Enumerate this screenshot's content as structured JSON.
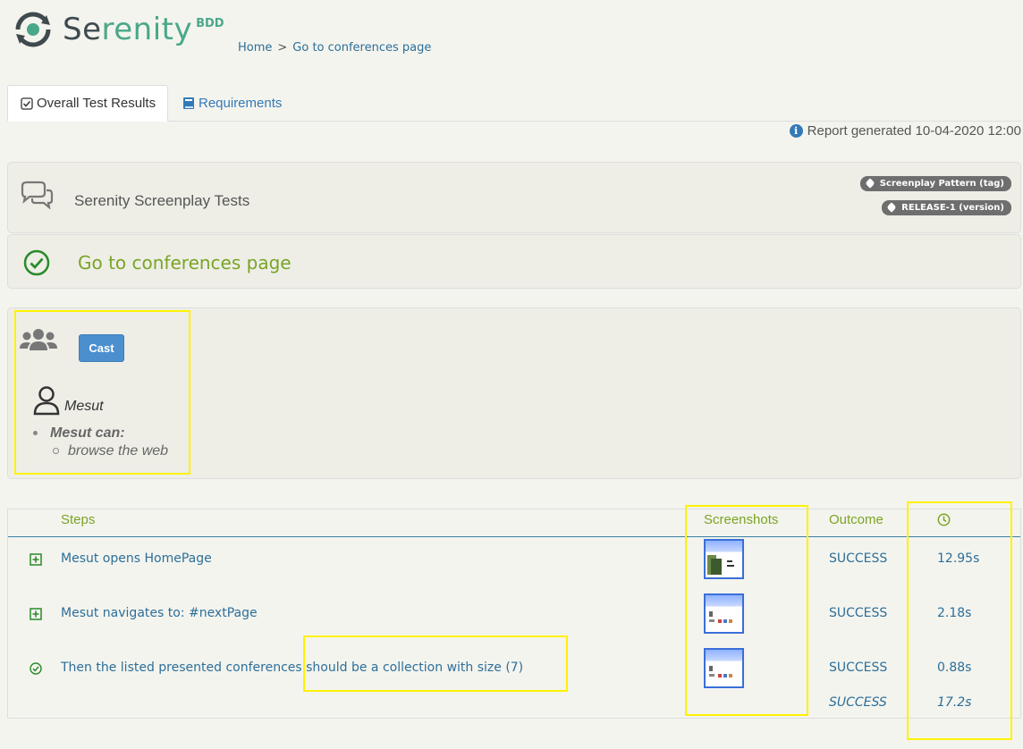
{
  "logo": {
    "brand_a": "Se",
    "brand_b": "renity",
    "sub": "BDD"
  },
  "breadcrumb": {
    "home": "Home",
    "sep": ">",
    "current": "Go to conferences page"
  },
  "tabs": [
    {
      "label": "Overall Test Results",
      "icon": "check-square-icon"
    },
    {
      "label": "Requirements",
      "icon": "book-icon"
    }
  ],
  "report": {
    "generated": "Report generated 10-04-2020 12:00"
  },
  "suite": {
    "title": "Serenity Screenplay Tests",
    "tags": [
      "Screenplay Pattern (tag)",
      "RELEASE-1 (version)"
    ]
  },
  "scenario": {
    "title": "Go to conferences page"
  },
  "cast": {
    "button": "Cast",
    "actor": "Mesut",
    "can_label": "Mesut can:",
    "abilities": [
      "browse the web"
    ]
  },
  "steps": {
    "headers": {
      "steps": "Steps",
      "screenshots": "Screenshots",
      "outcome": "Outcome"
    },
    "rows": [
      {
        "text": "Mesut opens HomePage",
        "outcome": "SUCCESS",
        "duration": "12.95s",
        "icon": "plus-square-icon"
      },
      {
        "text": "Mesut navigates to: #nextPage",
        "outcome": "SUCCESS",
        "duration": "2.18s",
        "icon": "plus-square-icon"
      },
      {
        "text": "Then the listed presented conferences should be a collection with size (7)",
        "outcome": "SUCCESS",
        "duration": "0.88s",
        "icon": "check-circle-icon"
      }
    ],
    "total": {
      "outcome": "SUCCESS",
      "duration": "17.2s"
    }
  },
  "colors": {
    "accent_green": "#7aa425",
    "link_blue": "#2c6f9a",
    "highlight": "#fff200"
  }
}
